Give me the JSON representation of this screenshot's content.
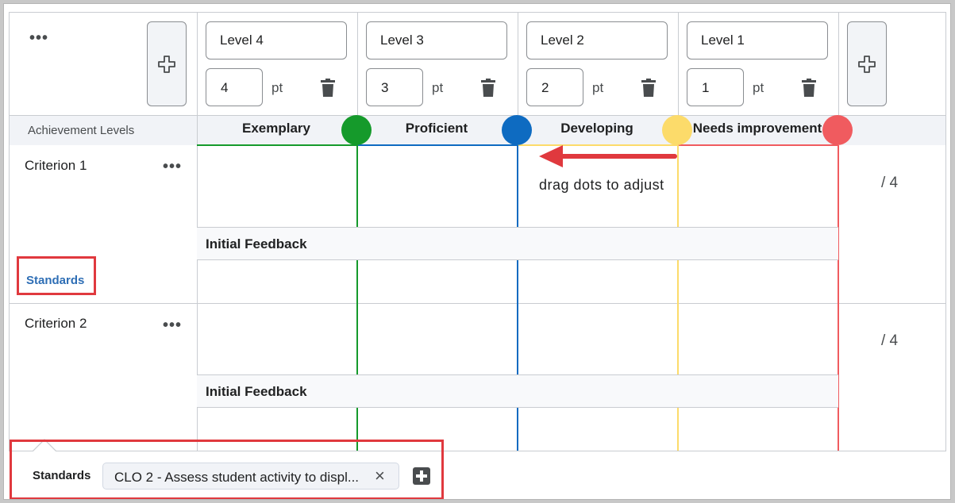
{
  "toolbar": {
    "more_label": "•••"
  },
  "levels": [
    {
      "name": "Level 4",
      "points": "4",
      "unit": "pt",
      "label": "Exemplary",
      "color": "#159a2b"
    },
    {
      "name": "Level 3",
      "points": "3",
      "unit": "pt",
      "label": "Proficient",
      "color": "#0e6bc1"
    },
    {
      "name": "Level 2",
      "points": "2",
      "unit": "pt",
      "label": "Developing",
      "color": "#fcdb6a"
    },
    {
      "name": "Level 1",
      "points": "1",
      "unit": "pt",
      "label": "Needs improvement",
      "color": "#f05b5f"
    }
  ],
  "achievement_levels_label": "Achievement Levels",
  "annotation": {
    "text": "drag dots to adjust",
    "color": "#e0393e"
  },
  "criteria": [
    {
      "name": "Criterion 1",
      "score": "/ 4",
      "feedback_label": "Initial Feedback",
      "standards_link": "Standards"
    },
    {
      "name": "Criterion 2",
      "score": "/ 4",
      "feedback_label": "Initial Feedback"
    }
  ],
  "standards_popup": {
    "label": "Standards",
    "chip_text": "CLO 2 - Assess student activity to displ...",
    "chip_remove": "×"
  },
  "icons": {
    "add": "add-plus-icon",
    "delete": "trash-icon",
    "more": "ellipsis-icon",
    "add_standard": "plus-square-icon"
  }
}
